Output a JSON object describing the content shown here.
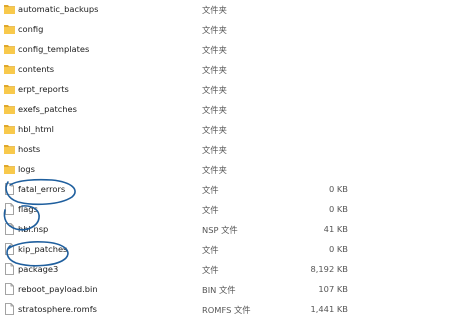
{
  "files": [
    {
      "name": "automatic_backups",
      "type": "文件夹",
      "size": "",
      "icon": "folder-icon"
    },
    {
      "name": "config",
      "type": "文件夹",
      "size": "",
      "icon": "folder-icon"
    },
    {
      "name": "config_templates",
      "type": "文件夹",
      "size": "",
      "icon": "folder-icon"
    },
    {
      "name": "contents",
      "type": "文件夹",
      "size": "",
      "icon": "folder-icon"
    },
    {
      "name": "erpt_reports",
      "type": "文件夹",
      "size": "",
      "icon": "folder-icon"
    },
    {
      "name": "exefs_patches",
      "type": "文件夹",
      "size": "",
      "icon": "folder-icon"
    },
    {
      "name": "hbl_html",
      "type": "文件夹",
      "size": "",
      "icon": "folder-icon"
    },
    {
      "name": "hosts",
      "type": "文件夹",
      "size": "",
      "icon": "folder-icon"
    },
    {
      "name": "logs",
      "type": "文件夹",
      "size": "",
      "icon": "folder-icon"
    },
    {
      "name": "fatal_errors",
      "type": "文件",
      "size": "0 KB",
      "icon": "file-icon"
    },
    {
      "name": "flags",
      "type": "文件",
      "size": "0 KB",
      "icon": "file-icon"
    },
    {
      "name": "hbl.nsp",
      "type": "NSP 文件",
      "size": "41 KB",
      "icon": "file-icon"
    },
    {
      "name": "kip_patches",
      "type": "文件",
      "size": "0 KB",
      "icon": "file-icon"
    },
    {
      "name": "package3",
      "type": "文件",
      "size": "8,192 KB",
      "icon": "file-icon"
    },
    {
      "name": "reboot_payload.bin",
      "type": "BIN 文件",
      "size": "107 KB",
      "icon": "file-icon"
    },
    {
      "name": "stratosphere.romfs",
      "type": "ROMFS 文件",
      "size": "1,441 KB",
      "icon": "file-icon"
    }
  ],
  "colors": {
    "folder": "#f8c94c",
    "folder_dark": "#e0a82c",
    "annotation": "#1f5f9e",
    "text": "#1b1b1b"
  }
}
